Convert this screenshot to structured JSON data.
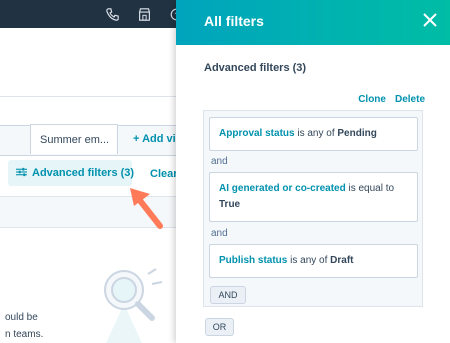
{
  "topbar": {
    "icons": [
      "phone-icon",
      "marketplace-icon",
      "help-icon"
    ]
  },
  "background": {
    "tab_label": "Summer em...",
    "add_view_label": "+ Add vi",
    "advanced_filters_label": "Advanced filters (3)",
    "clear_label": "Clear",
    "text_line1": "ould be",
    "text_line2": "n teams."
  },
  "panel": {
    "title": "All filters",
    "section_title": "Advanced filters (3)",
    "clone_label": "Clone",
    "delete_label": "Delete",
    "filters": [
      {
        "property": "Approval status",
        "operator": "is any of",
        "value": "Pending"
      },
      {
        "property": "AI generated or co-created",
        "operator": "is equal to",
        "value": "True"
      },
      {
        "property": "Publish status",
        "operator": "is any of",
        "value": "Draft"
      }
    ],
    "and_label": "and",
    "and_button": "AND",
    "or_button": "OR"
  },
  "colors": {
    "header_start": "#00a4bd",
    "header_end": "#00bda5",
    "link": "#0091ae",
    "arrow": "#ff7a59",
    "topbar": "#213343"
  }
}
